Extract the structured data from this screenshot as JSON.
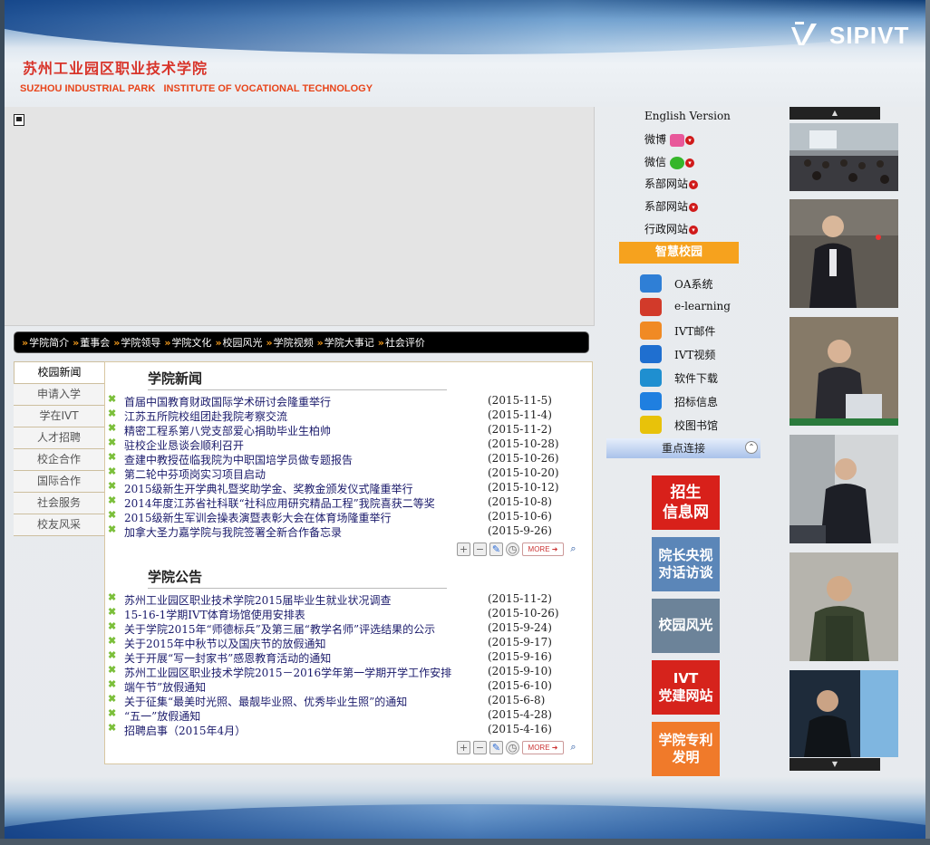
{
  "header": {
    "cn_title": "苏州工业园区职业技术学院",
    "en_title": "SUZHOU INDUSTRIAL PARK   INSTITUTE OF VOCATIONAL TECHNOLOGY",
    "logo_text": "SIPIVT",
    "logo_icon": "sipivt-logo"
  },
  "navbar": {
    "items": [
      "学院简介",
      "董事会",
      "学院领导",
      "学院文化",
      "校园风光",
      "学院视频",
      "学院大事记",
      "社会评价"
    ]
  },
  "tabs": [
    "校园新闻",
    "申请入学",
    "学在IVT",
    "人才招聘",
    "校企合作",
    "国际合作",
    "社会服务",
    "校友风采"
  ],
  "news": {
    "title": "学院新闻",
    "items": [
      {
        "text": "首届中国教育财政国际学术研讨会隆重举行",
        "date": "(2015-11-5)"
      },
      {
        "text": "江苏五所院校组团赴我院考察交流",
        "date": "(2015-11-4)"
      },
      {
        "text": "精密工程系第八党支部爱心捐助毕业生柏帅",
        "date": "(2015-11-2)"
      },
      {
        "text": "驻校企业恳谈会顺利召开",
        "date": "(2015-10-28)"
      },
      {
        "text": "查建中教授莅临我院为中职国培学员做专题报告",
        "date": "(2015-10-26)"
      },
      {
        "text": "第二轮中芬项岗实习项目启动",
        "date": "(2015-10-20)"
      },
      {
        "text": "2015级新生开学典礼暨奖助学金、奖教金颁发仪式隆重举行",
        "date": "(2015-10-12)"
      },
      {
        "text": "2014年度江苏省社科联“社科应用研究精品工程”我院喜获二等奖",
        "date": "(2015-10-8)"
      },
      {
        "text": "2015级新生军训会操表演暨表彰大会在体育场隆重举行",
        "date": "(2015-10-6)"
      },
      {
        "text": "加拿大圣力嘉学院与我院签署全新合作备忘录",
        "date": "(2015-9-26)"
      }
    ]
  },
  "notices": {
    "title": "学院公告",
    "items": [
      {
        "text": "苏州工业园区职业技术学院2015届毕业生就业状况调查",
        "date": "(2015-11-2)"
      },
      {
        "text": "15-16-1学期IVT体育场馆使用安排表",
        "date": "(2015-10-26)"
      },
      {
        "text": "关于学院2015年“师德标兵”及第三届“教学名师”评选结果的公示",
        "date": "(2015-9-24)"
      },
      {
        "text": "关于2015年中秋节以及国庆节的放假通知",
        "date": "(2015-9-17)"
      },
      {
        "text": "关于开展“写一封家书”感恩教育活动的通知",
        "date": "(2015-9-16)"
      },
      {
        "text": "苏州工业园区职业技术学院2015－2016学年第一学期开学工作安排",
        "date": "(2015-9-10)"
      },
      {
        "text": "端午节”放假通知",
        "date": "(2015-6-10)"
      },
      {
        "text": "关于征集“最美时光照、最靓毕业照、优秀毕业生照”的通知",
        "date": "(2015-6-8)"
      },
      {
        "text": "“五一”放假通知",
        "date": "(2015-4-28)"
      },
      {
        "text": "招聘启事（2015年4月）",
        "date": "(2015-4-16)"
      }
    ]
  },
  "tools": {
    "more_label": "MORE ➜"
  },
  "side": {
    "english": "English Version",
    "weibo": "微博",
    "wechat": "微信",
    "dept1": "系部网站",
    "dept2": "系部网站",
    "admin": "行政网站",
    "smart_campus": "智慧校园",
    "services": [
      {
        "label": "OA系统",
        "icon": "users-icon",
        "color": "#2f7fd6"
      },
      {
        "label": "e-learning",
        "icon": "elearning-icon",
        "color": "#d23a2a"
      },
      {
        "label": "IVT邮件",
        "icon": "mail-icon",
        "color": "#f08a24"
      },
      {
        "label": "IVT视频",
        "icon": "video-icon",
        "color": "#1f6fd0"
      },
      {
        "label": "软件下载",
        "icon": "download-icon",
        "color": "#1f8fd0"
      },
      {
        "label": "招标信息",
        "icon": "bid-icon",
        "color": "#1f7fe0"
      },
      {
        "label": "校图书馆",
        "icon": "library-icon",
        "color": "#e8c20a"
      }
    ],
    "key_links": "重点连接",
    "banners": [
      {
        "label": "招生\n信息网",
        "color": "#d8201a"
      },
      {
        "label": "院长央视\n对话访谈",
        "color": "#5b86b8"
      },
      {
        "label": "校园风光",
        "color": "#6c8399"
      },
      {
        "label": "IVT\n党建网站",
        "color": "#d6231c"
      },
      {
        "label": "学院专利\n发明",
        "color": "#f07a2a"
      }
    ]
  },
  "photos": [
    "photo-meeting",
    "photo-speaker-1",
    "photo-speaker-2",
    "photo-speaker-3",
    "photo-speaker-4",
    "photo-speaker-5"
  ]
}
